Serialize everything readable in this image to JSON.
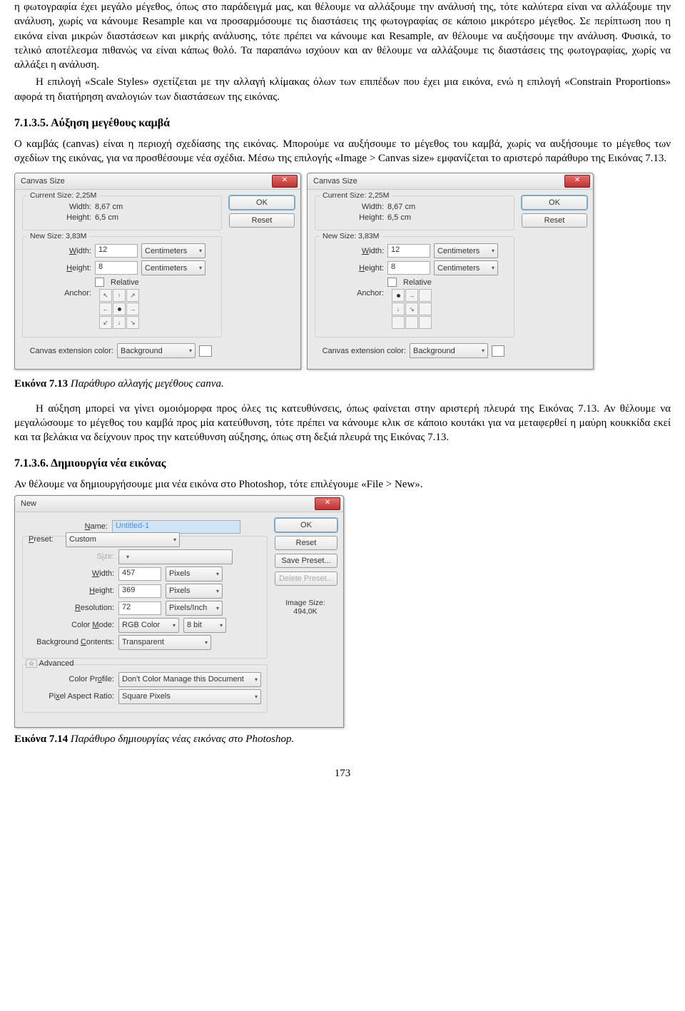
{
  "para1": "η φωτογραφία έχει μεγάλο μέγεθος, όπως στο παράδειγμά μας, και θέλουμε να αλλάξουμε την ανάλυσή της, τότε καλύτερα είναι να αλλάξουμε την ανάλυση, χωρίς να κάνουμε Resample και να προσαρμόσουμε τις διαστάσεις της φωτογραφίας σε κάποιο μικρότερο μέγεθος. Σε περίπτωση που η εικόνα είναι μικρών διαστάσεων και μικρής ανάλυσης, τότε πρέπει να κάνουμε και Resample, αν θέλουμε να αυξήσουμε την ανάλυση. Φυσικά, το τελικό αποτέλεσμα πιθανώς να είναι κάπως θολό. Τα παραπάνω ισχύουν και αν θέλουμε να αλλάξουμε τις διαστάσεις της φωτογραφίας, χωρίς να αλλάξει η ανάλυση.",
  "para2": "Η επιλογή «Scale Styles» σχετίζεται με την αλλαγή κλίμακας όλων των επιπέδων που έχει μια εικόνα, ενώ η επιλογή «Constrain Proportions» αφορά τη διατήρηση αναλογιών των διαστάσεων της εικόνας.",
  "h_7135": "7.1.3.5. Αύξηση μεγέθους καμβά",
  "para3": "Ο καμβάς (canvas) είναι η περιοχή σχεδίασης της εικόνας. Μπορούμε να αυξήσουμε το μέγεθος του καμβά, χωρίς να αυξήσουμε το μέγεθος των σχεδίων της εικόνας, για να προσθέσουμε νέα σχέδια. Μέσω της επιλογής «Image > Canvas size» εμφανίζεται το αριστερό παράθυρο της Εικόνας 7.13.",
  "canvas": {
    "title": "Canvas Size",
    "ok": "OK",
    "reset": "Reset",
    "cur": "Current Size: 2,25M",
    "cw_l": "Width:",
    "cw_v": "8,67 cm",
    "ch_l": "Height:",
    "ch_v": "6,5 cm",
    "new": "New Size: 3,83M",
    "nw_l": "Width:",
    "nw_v": "12",
    "nh_l": "Height:",
    "nh_v": "8",
    "unit": "Centimeters",
    "rel": "Relative",
    "anch": "Anchor:",
    "ext_l": "Canvas extension color:",
    "ext_v": "Background"
  },
  "cap713b": "Εικόνα 7.13 ",
  "cap713i": "Παράθυρο αλλαγής μεγέθους canva.",
  "para4": "Η αύξηση μπορεί να γίνει ομοιόμορφα προς όλες τις κατευθύνσεις, όπως φαίνεται στην αριστερή πλευρά της Εικόνας 7.13. Αν θέλουμε να μεγαλώσουμε το μέγεθος του καμβά προς μία κατεύθυνση, τότε πρέπει να κάνουμε κλικ σε κάποιο κουτάκι για να μεταφερθεί η μαύρη κουκκίδα εκεί και τα βελάκια να δείχνουν προς την κατεύθυνση αύξησης, όπως στη δεξιά πλευρά της Εικόνας 7.13.",
  "h_7136": "7.1.3.6. Δημιουργία νέα εικόνας",
  "para5": "Αν θέλουμε να δημιουργήσουμε μια νέα εικόνα στο Photoshop, τότε επιλέγουμε «File > New».",
  "nd": {
    "title": "New",
    "ok": "OK",
    "reset": "Reset",
    "save": "Save Preset...",
    "del": "Delete Preset...",
    "name_l": "Name:",
    "name_v": "Untitled-1",
    "preset_l": "Preset:",
    "preset_v": "Custom",
    "size_l": "Size:",
    "w_l": "Width:",
    "w_v": "457",
    "w_u": "Pixels",
    "h_l": "Height:",
    "h_v": "369",
    "h_u": "Pixels",
    "r_l": "Resolution:",
    "r_v": "72",
    "r_u": "Pixels/Inch",
    "cm_l": "Color Mode:",
    "cm_v": "RGB Color",
    "cm_b": "8 bit",
    "bg_l": "Background Contents:",
    "bg_v": "Transparent",
    "adv": "Advanced",
    "cp_l": "Color Profile:",
    "cp_v": "Don't Color Manage this Document",
    "par_l": "Pixel Aspect Ratio:",
    "par_v": "Square Pixels",
    "isz_l": "Image Size:",
    "isz_v": "494,0K"
  },
  "cap714b": "Εικόνα 7.14 ",
  "cap714i": "Παράθυρο δημιουργίας νέας εικόνας στο Photoshop.",
  "page": "173"
}
